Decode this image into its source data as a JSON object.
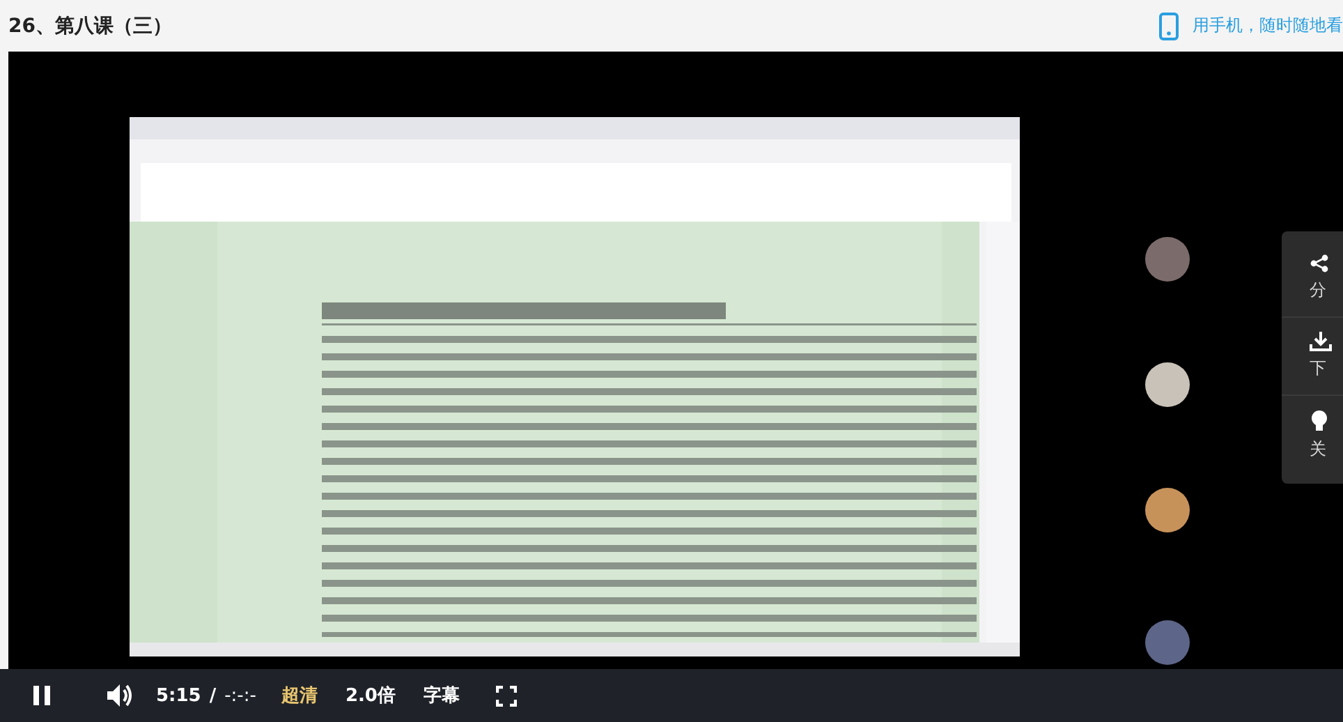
{
  "header": {
    "title": "26、第八课（三）",
    "mobile_link": "用手机，随时随地看"
  },
  "video": {
    "kind": "picture",
    "side_menu": [
      {
        "kind": "share",
        "label": "分"
      },
      {
        "kind": "download",
        "label": "下"
      },
      {
        "kind": "light",
        "label": "关"
      }
    ]
  },
  "controls": {
    "playing": true,
    "current_time": "5:15",
    "separator": "/",
    "duration": "-:-:-",
    "quality": "超清",
    "speed": "2.0倍",
    "subtitles": "字幕"
  }
}
